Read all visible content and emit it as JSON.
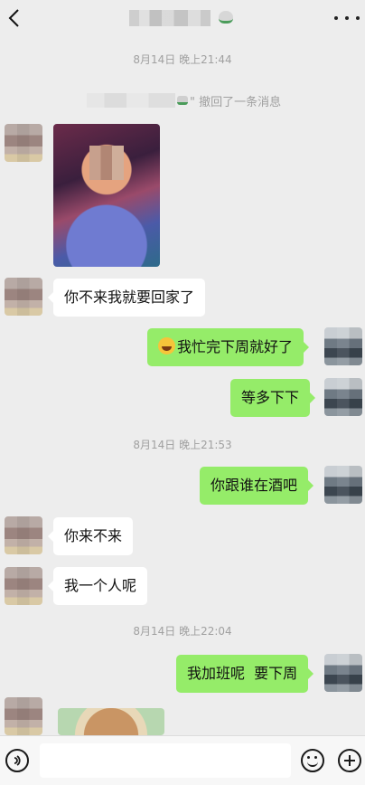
{
  "header": {
    "back_icon": "chevron-left-icon",
    "more_icon": "ellipsis-icon"
  },
  "chat": {
    "time1": "8月14日 晚上21:44",
    "recall_text": "\" 撤回了一条消息",
    "msg_left_1": "你不来我就要回家了",
    "msg_right_1": "我忙完下周就好了",
    "msg_right_2": "等多下下",
    "time2": "8月14日 晚上21:53",
    "msg_right_3": "你跟谁在酒吧",
    "msg_left_2": "你来不来",
    "msg_left_3": "我一个人呢",
    "time3": "8月14日 晚上22:04",
    "msg_right_4": "我加班呢  要下周"
  },
  "colors": {
    "bubble_sent": "#95ec69",
    "bubble_received": "#ffffff",
    "background": "#ededed"
  },
  "input_bar": {
    "voice_icon": "voice-icon",
    "emoji_icon": "smiley-icon",
    "plus_icon": "plus-icon"
  }
}
